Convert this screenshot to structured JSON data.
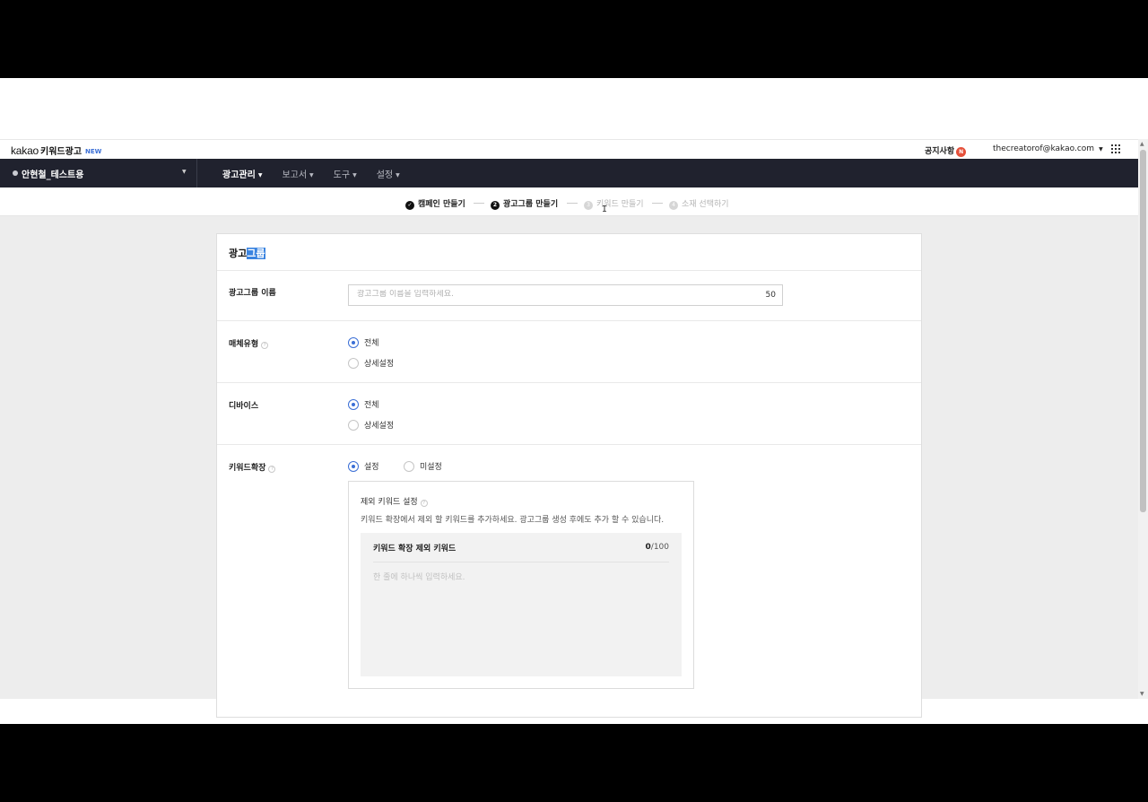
{
  "header": {
    "brand": "kakao",
    "product": "키워드광고",
    "new_badge": "NEW",
    "notice_label": "공지사항",
    "notice_badge": "N",
    "account_email": "thecreatorof@kakao.com"
  },
  "nav": {
    "ad_account": "안현철_테스트용",
    "menu": [
      "광고관리",
      "보고서",
      "도구",
      "설정"
    ],
    "active_index": 0
  },
  "steps": [
    {
      "num": "✓",
      "label": "캠페인 만들기",
      "state": "done"
    },
    {
      "num": "2",
      "label": "광고그룹 만들기",
      "state": "current"
    },
    {
      "num": "3",
      "label": "키워드 만들기",
      "state": "todo"
    },
    {
      "num": "4",
      "label": "소재 선택하기",
      "state": "todo"
    }
  ],
  "form": {
    "title_plain": "광고",
    "title_selected": "그룹",
    "name_label": "광고그룹 이름",
    "name_placeholder": "광고그룹 이름을 입력하세요.",
    "name_count": "50",
    "media_label": "매체유형",
    "media_options": [
      "전체",
      "상세설정"
    ],
    "device_label": "디바이스",
    "device_options": [
      "전체",
      "상세설정"
    ],
    "expand_label": "키워드확장",
    "expand_options": [
      "설정",
      "미설정"
    ],
    "exclude": {
      "title": "제외 키워드 설정",
      "description": "키워드 확장에서 제외 할 키워드를 추가하세요. 광고그룹 생성 후에도 추가 할 수 있습니다.",
      "list_header": "키워드 확장 제외 키워드",
      "count_current": "0",
      "count_max": "/100",
      "placeholder": "한 줄에 하나씩 입력하세요."
    }
  }
}
